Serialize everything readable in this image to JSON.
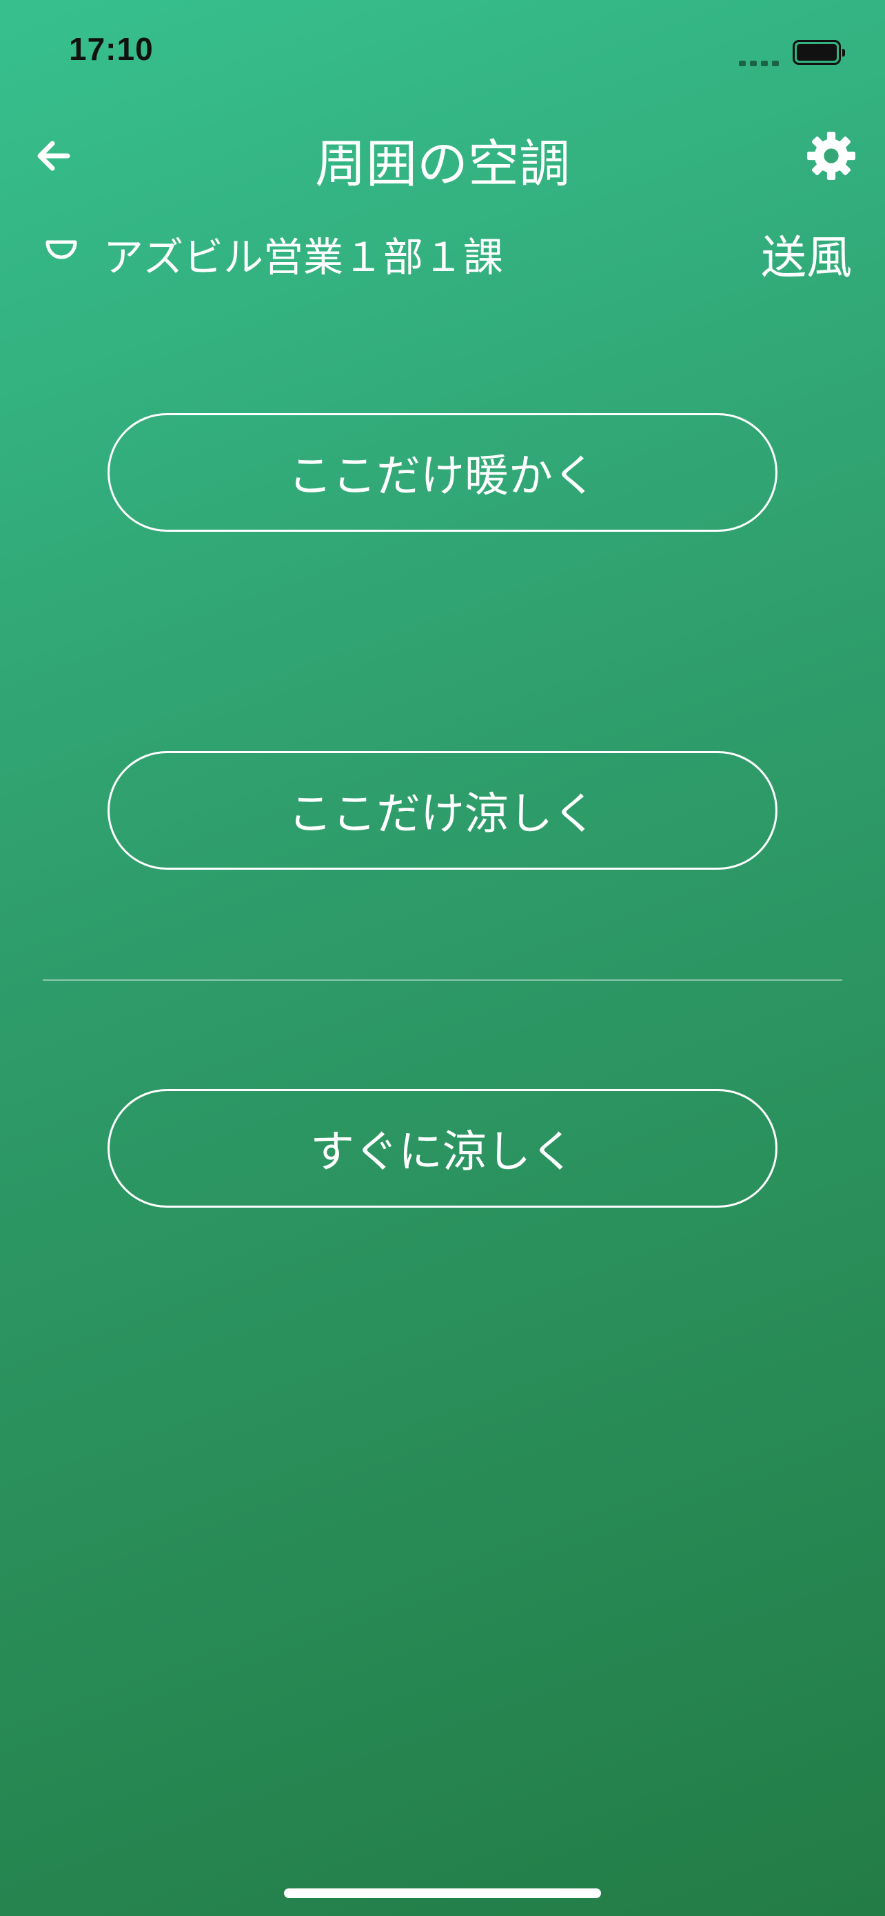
{
  "status_bar": {
    "time": "17:10"
  },
  "nav": {
    "title": "周囲の空調",
    "back_icon": "arrow-left-icon",
    "settings_icon": "gear-icon"
  },
  "location": {
    "icon": "location-icon",
    "name": "アズビル営業１部１課",
    "mode": "送風"
  },
  "actions": {
    "warm_label": "ここだけ暖かく",
    "cool_label": "ここだけ涼しく",
    "quick_cool_label": "すぐに涼しく"
  },
  "colors": {
    "gradient_start": "#37c08e",
    "gradient_end": "#237c45",
    "foreground": "#ffffff"
  }
}
